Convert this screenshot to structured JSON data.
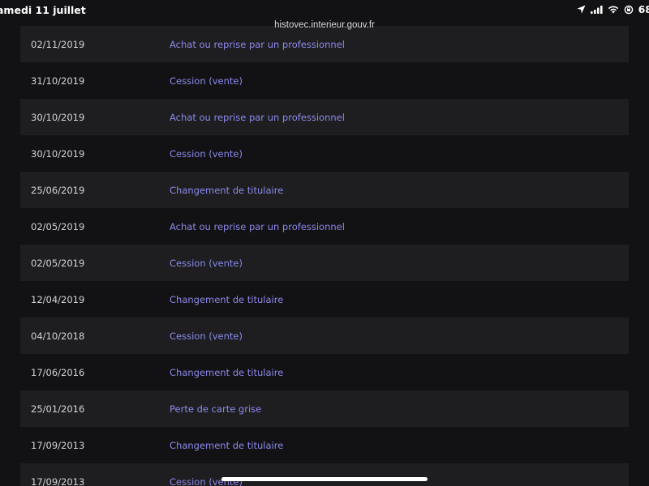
{
  "status_bar": {
    "time_text": "amedi 11 juillet",
    "battery_text": "68",
    "icons": [
      "location-arrow-icon",
      "cellular-signal-icon",
      "wifi-icon",
      "rotation-lock-icon"
    ]
  },
  "browser": {
    "url": "histovec.interieur.gouv.fr"
  },
  "history": {
    "rows": [
      {
        "date": "02/11/2019",
        "event": "Achat ou reprise par un professionnel"
      },
      {
        "date": "31/10/2019",
        "event": "Cession (vente)"
      },
      {
        "date": "30/10/2019",
        "event": "Achat ou reprise par un professionnel"
      },
      {
        "date": "30/10/2019",
        "event": "Cession (vente)"
      },
      {
        "date": "25/06/2019",
        "event": "Changement de titulaire"
      },
      {
        "date": "02/05/2019",
        "event": "Achat ou reprise par un professionnel"
      },
      {
        "date": "02/05/2019",
        "event": "Cession (vente)"
      },
      {
        "date": "12/04/2019",
        "event": "Changement de titulaire"
      },
      {
        "date": "04/10/2018",
        "event": "Cession (vente)"
      },
      {
        "date": "17/06/2016",
        "event": "Changement de titulaire"
      },
      {
        "date": "25/01/2016",
        "event": "Perte de carte grise"
      },
      {
        "date": "17/09/2013",
        "event": "Changement de titulaire"
      },
      {
        "date": "17/09/2013",
        "event": "Cession (vente)"
      }
    ]
  },
  "colors": {
    "background": "#121214",
    "row_shaded": "#1e1e20",
    "event_link": "#8d89ec",
    "date_text": "#d5d5d8"
  }
}
